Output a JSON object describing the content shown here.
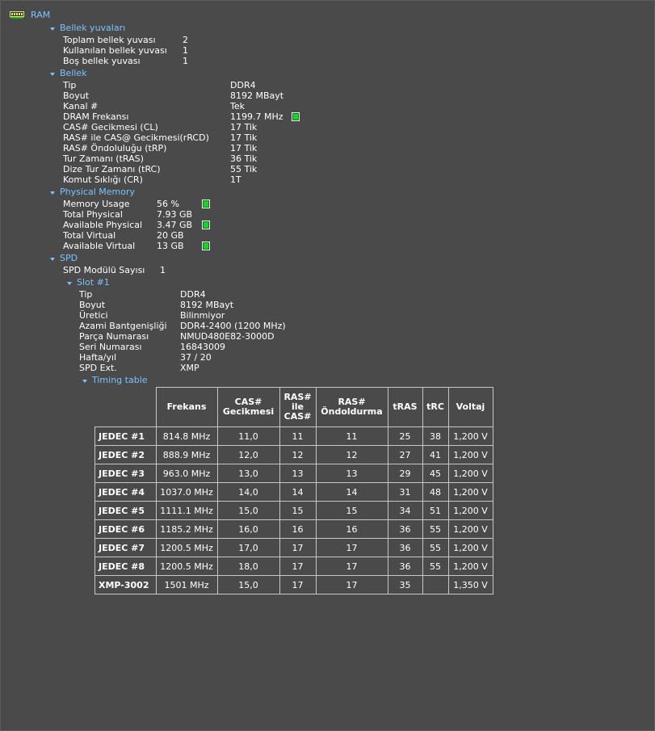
{
  "root": {
    "label": "RAM"
  },
  "slots_section": {
    "title": "Bellek yuvaları",
    "rows": [
      {
        "label": "Toplam bellek yuvası",
        "value": "2"
      },
      {
        "label": "Kullanılan bellek yuvası",
        "value": "1"
      },
      {
        "label": "Boş bellek yuvası",
        "value": "1"
      }
    ]
  },
  "memory_section": {
    "title": "Bellek",
    "rows": [
      {
        "label": "Tip",
        "value": "DDR4"
      },
      {
        "label": "Boyut",
        "value": "8192 MBayt"
      },
      {
        "label": "Kanal #",
        "value": "Tek"
      },
      {
        "label": "DRAM Frekansı",
        "value": "1199.7 MHz"
      },
      {
        "label": "CAS# Gecikmesi (CL)",
        "value": "17 Tik"
      },
      {
        "label": "RAS# ile CAS@ Gecikmesi(rRCD)",
        "value": "17 Tik"
      },
      {
        "label": "RAS# Öndoluluğu (tRP)",
        "value": "17 Tik"
      },
      {
        "label": "Tur Zamanı (tRAS)",
        "value": "36 Tik"
      },
      {
        "label": "Dize Tur Zamanı (tRC)",
        "value": "55 Tik"
      },
      {
        "label": "Komut Sıklığı (CR)",
        "value": "1T"
      }
    ]
  },
  "physical_section": {
    "title": "Physical Memory",
    "rows": [
      {
        "label": "Memory Usage",
        "value": "56 %"
      },
      {
        "label": "Total Physical",
        "value": "7.93 GB"
      },
      {
        "label": "Available Physical",
        "value": "3.47 GB"
      },
      {
        "label": "Total Virtual",
        "value": "20 GB"
      },
      {
        "label": "Available Virtual",
        "value": "13 GB"
      }
    ]
  },
  "spd_section": {
    "title": "SPD",
    "module_count_label": "SPD Modülü Sayısı",
    "module_count_value": "1",
    "slot": {
      "title": "Slot #1",
      "rows": [
        {
          "label": "Tip",
          "value": "DDR4"
        },
        {
          "label": "Boyut",
          "value": "8192 MBayt"
        },
        {
          "label": "Üretici",
          "value": "Bilinmiyor"
        },
        {
          "label": "Azami Bantgenişliği",
          "value": "DDR4-2400 (1200 MHz)"
        },
        {
          "label": "Parça Numarası",
          "value": "NMUD480E82-3000D"
        },
        {
          "label": "Seri Numarası",
          "value": "16843009"
        },
        {
          "label": "Hafta/yıl",
          "value": "37 / 20"
        },
        {
          "label": "SPD Ext.",
          "value": "XMP"
        }
      ]
    },
    "timing": {
      "title": "Timing table",
      "headers": [
        "Frekans",
        "CAS#\nGecikmesi",
        "RAS#\nile\nCAS#",
        "RAS#\nÖndoldurma",
        "tRAS",
        "tRC",
        "Voltaj"
      ],
      "rows": [
        {
          "name": "JEDEC #1",
          "cells": [
            "814.8 MHz",
            "11,0",
            "11",
            "11",
            "25",
            "38",
            "1,200 V"
          ]
        },
        {
          "name": "JEDEC #2",
          "cells": [
            "888.9 MHz",
            "12,0",
            "12",
            "12",
            "27",
            "41",
            "1,200 V"
          ]
        },
        {
          "name": "JEDEC #3",
          "cells": [
            "963.0 MHz",
            "13,0",
            "13",
            "13",
            "29",
            "45",
            "1,200 V"
          ]
        },
        {
          "name": "JEDEC #4",
          "cells": [
            "1037.0 MHz",
            "14,0",
            "14",
            "14",
            "31",
            "48",
            "1,200 V"
          ]
        },
        {
          "name": "JEDEC #5",
          "cells": [
            "1111.1 MHz",
            "15,0",
            "15",
            "15",
            "34",
            "51",
            "1,200 V"
          ]
        },
        {
          "name": "JEDEC #6",
          "cells": [
            "1185.2 MHz",
            "16,0",
            "16",
            "16",
            "36",
            "55",
            "1,200 V"
          ]
        },
        {
          "name": "JEDEC #7",
          "cells": [
            "1200.5 MHz",
            "17,0",
            "17",
            "17",
            "36",
            "55",
            "1,200 V"
          ]
        },
        {
          "name": "JEDEC #8",
          "cells": [
            "1200.5 MHz",
            "18,0",
            "17",
            "17",
            "36",
            "55",
            "1,200 V"
          ]
        },
        {
          "name": "XMP-3002",
          "cells": [
            "1501 MHz",
            "15,0",
            "17",
            "17",
            "35",
            "",
            "1,350 V"
          ]
        }
      ]
    }
  },
  "colors": {
    "background": "#4a4a4a",
    "header_text": "#79c3ff",
    "indicator": "#1bd12b"
  }
}
